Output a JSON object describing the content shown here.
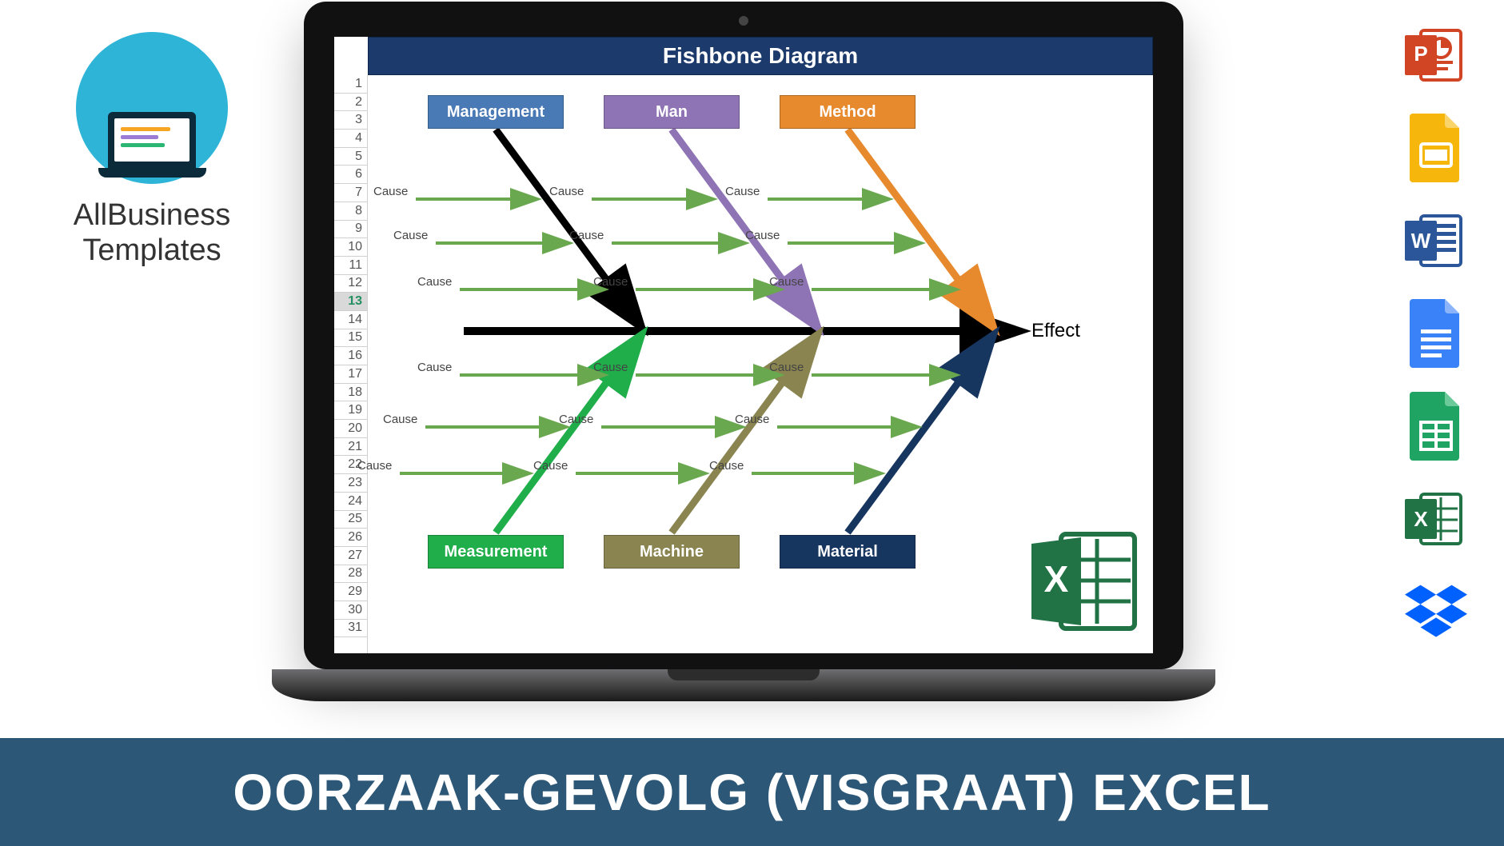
{
  "brand": {
    "name": "AllBusiness Templates"
  },
  "banner": {
    "text": "OORZAAK-GEVOLG (VISGRAAT) EXCEL"
  },
  "diagram": {
    "title": "Fishbone Diagram",
    "effect_label": "Effect",
    "cause_label": "Cause",
    "categories_top": [
      {
        "name": "Management",
        "color": "#4a7ab5"
      },
      {
        "name": "Man",
        "color": "#8f74b5"
      },
      {
        "name": "Method",
        "color": "#e78a2e"
      }
    ],
    "categories_bottom": [
      {
        "name": "Measurement",
        "color": "#1fae4a"
      },
      {
        "name": "Machine",
        "color": "#8a8450"
      },
      {
        "name": "Material",
        "color": "#17365f"
      }
    ]
  },
  "right_icons": [
    "powerpoint",
    "google-slides",
    "word",
    "google-docs",
    "google-sheets",
    "excel",
    "dropbox"
  ]
}
